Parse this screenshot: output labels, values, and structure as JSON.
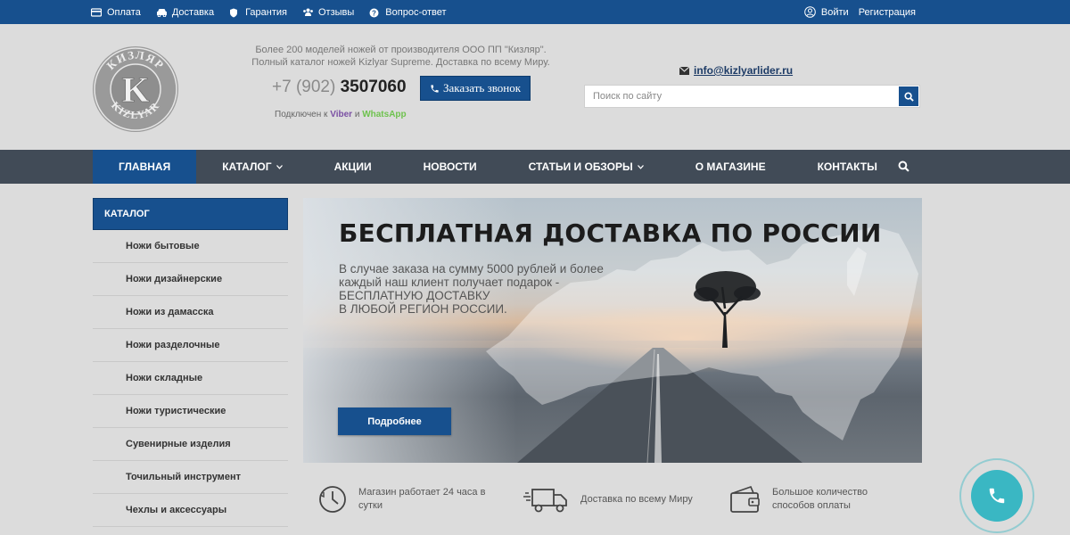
{
  "topbar": {
    "links": [
      "Оплата",
      "Доставка",
      "Гарантия",
      "Отзывы",
      "Вопрос-ответ"
    ],
    "login": "Войти",
    "register": "Регистрация"
  },
  "header": {
    "logo_text": "КИЗЛЯР KIZLYAR",
    "tagline_1": "Более 200 моделей ножей от производителя ООО ПП \"Кизляр\".",
    "tagline_2": "Полный каталог ножей Kizlyar Supreme.  Доставка по всему Миру.",
    "phone_prefix": "+7 (902)",
    "phone_number": "3507060",
    "call_button": "Заказать звонок",
    "messengers_prefix": "Подключен к",
    "viber": "Viber",
    "and": "и",
    "whatsapp": "WhatsApp",
    "email": "info@kizlyarlider.ru",
    "search_placeholder": "Поиск по сайту"
  },
  "nav": {
    "items": [
      "ГЛАВНАЯ",
      "КАТАЛОГ",
      "АКЦИИ",
      "НОВОСТИ",
      "СТАТЬИ И ОБЗОРЫ",
      "О МАГАЗИНЕ",
      "КОНТАКТЫ"
    ]
  },
  "sidebar": {
    "title": "КАТАЛОГ",
    "items": [
      "Ножи бытовые",
      "Ножи дизайнерские",
      "Ножи из дамасска",
      "Ножи разделочные",
      "Ножи складные",
      "Ножи туристические",
      "Сувенирные изделия",
      "Точильный инструмент",
      "Чехлы и аксессуары"
    ]
  },
  "banner": {
    "title": "БЕСПЛАТНАЯ ДОСТАВКА ПО РОССИИ",
    "text": "В случае заказа на сумму 5000 рублей и более\nкаждый наш клиент получает подарок -\nБЕСПЛАТНУЮ ДОСТАВКУ\nВ ЛЮБОЙ РЕГИОН РОССИИ.",
    "button": "Подробнее"
  },
  "features": {
    "f1_line1": "Магазин работает 24 часа в",
    "f1_line2": "сутки",
    "f2": "Доставка по всему Миру",
    "f3_line1": "Большое количество",
    "f3_line2": "способов оплаты"
  },
  "colors": {
    "brand_blue": "#17508e",
    "nav_dark": "#414b57",
    "call_teal": "#3ab7c3"
  }
}
